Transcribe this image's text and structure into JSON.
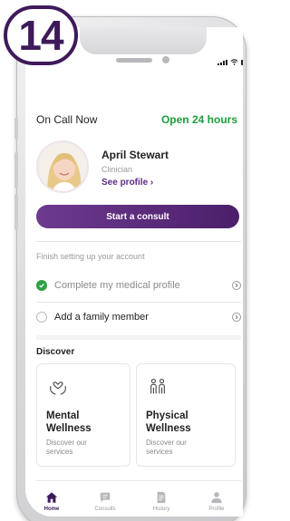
{
  "step_badge": "14",
  "on_call": {
    "title": "On Call Now",
    "availability": "Open 24 hours"
  },
  "clinician": {
    "name": "April Stewart",
    "role": "Clinician",
    "profile_link": "See profile ›"
  },
  "start_button": "Start a consult",
  "account_setup": {
    "heading": "Finish setting up your account",
    "tasks": [
      {
        "label": "Complete my medical profile",
        "done": true
      },
      {
        "label": "Add a family member",
        "done": false
      }
    ]
  },
  "discover": {
    "heading": "Discover",
    "cards": [
      {
        "title_line1": "Mental",
        "title_line2": "Wellness",
        "sub_line1": "Discover our",
        "sub_line2": "services"
      },
      {
        "title_line1": "Physical",
        "title_line2": "Wellness",
        "sub_line1": "Discover our",
        "sub_line2": "services"
      }
    ]
  },
  "nav": {
    "items": [
      "Home",
      "Consults",
      "History",
      "Profile"
    ],
    "active": "Home"
  },
  "colors": {
    "brand_purple": "#3f1a5a",
    "accent_green": "#1f9d3a"
  }
}
